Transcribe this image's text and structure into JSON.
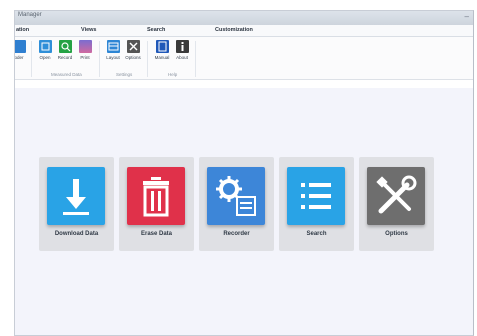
{
  "window": {
    "title": "Manager"
  },
  "tabs": [
    {
      "label": "ation"
    },
    {
      "label": "Views"
    },
    {
      "label": "Search"
    },
    {
      "label": "Customization"
    }
  ],
  "ribbon": {
    "buttons": [
      {
        "label": "oder",
        "icon": "recorder-icon"
      },
      {
        "label": "Open",
        "icon": "open-icon"
      },
      {
        "label": "Record",
        "icon": "record-icon"
      },
      {
        "label": "Print",
        "icon": "print-icon"
      },
      {
        "label": "Layout",
        "icon": "layout-icon"
      },
      {
        "label": "Options",
        "icon": "options-icon"
      },
      {
        "label": "Manual",
        "icon": "manual-icon"
      },
      {
        "label": "About",
        "icon": "about-icon"
      }
    ],
    "groups": [
      {
        "label": "Measured Data"
      },
      {
        "label": "Settings"
      },
      {
        "label": "Help"
      }
    ]
  },
  "tiles": [
    {
      "label": "Download Data",
      "icon": "download-icon",
      "color": "#29a3e6"
    },
    {
      "label": "Erase Data",
      "icon": "trash-icon",
      "color": "#e0314a"
    },
    {
      "label": "Recorder",
      "icon": "recorder-gear-icon",
      "color": "#3d86d8"
    },
    {
      "label": "Search",
      "icon": "list-icon",
      "color": "#29a3e6"
    },
    {
      "label": "Options",
      "icon": "tools-icon",
      "color": "#6e6e6e"
    }
  ]
}
